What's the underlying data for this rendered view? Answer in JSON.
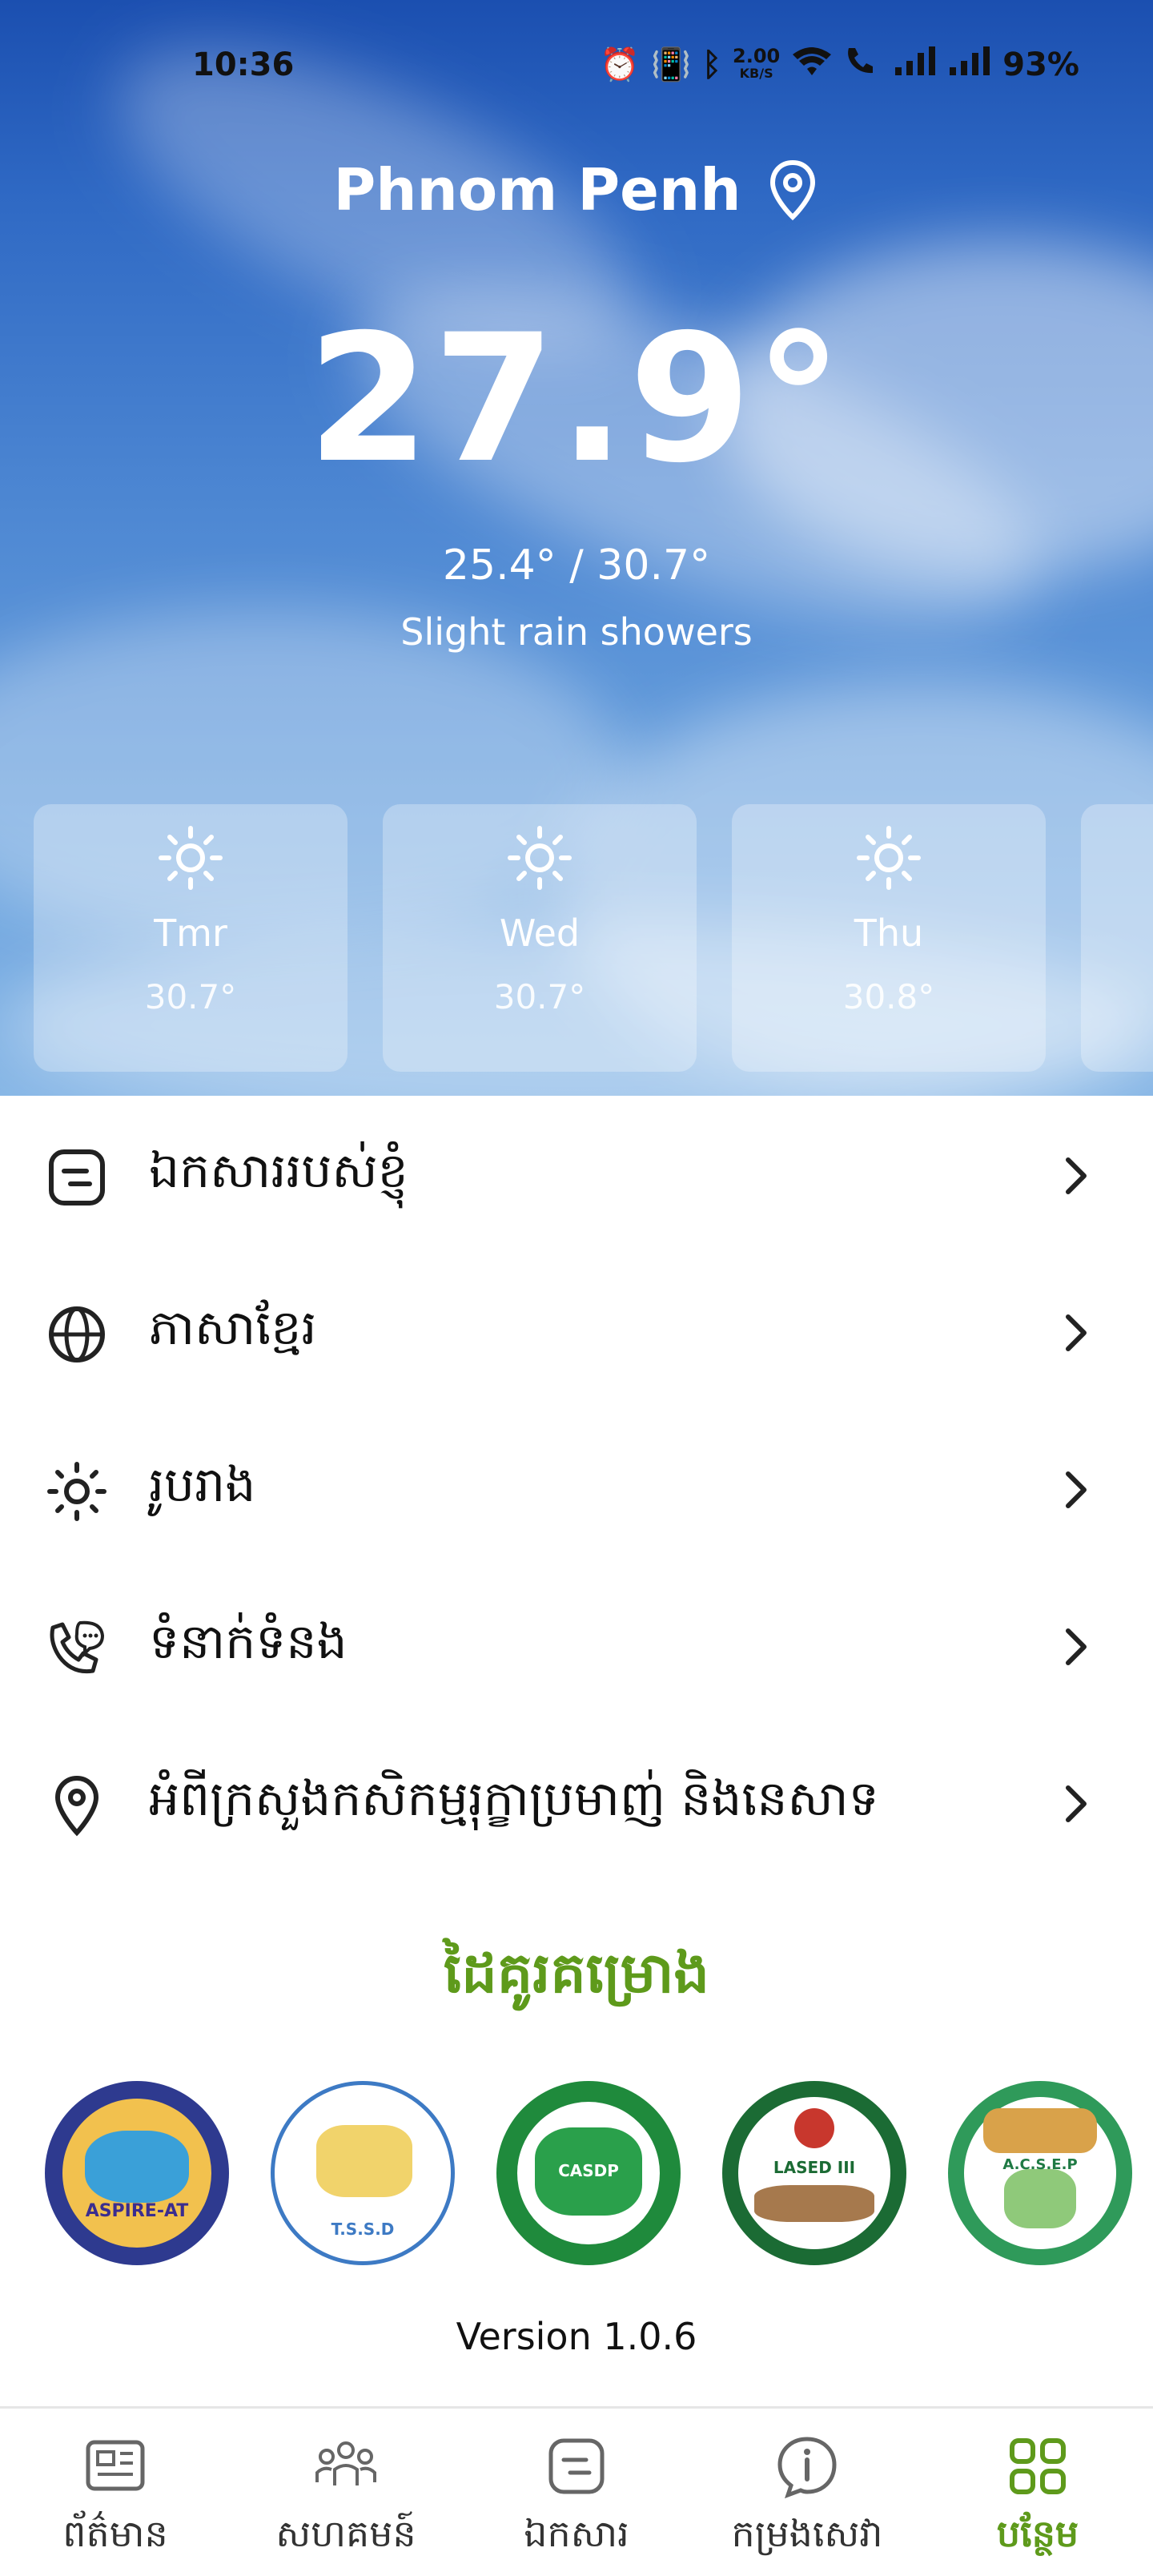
{
  "status_bar": {
    "time": "10:36",
    "speed_value": "2.00",
    "speed_unit": "KB/S",
    "battery": "93%"
  },
  "weather": {
    "city": "Phnom Penh",
    "temperature": "27.9°",
    "range": "25.4° / 30.7°",
    "condition": "Slight rain showers",
    "forecast": [
      {
        "day": "Tmr",
        "temp": "30.7°",
        "icon": "sun-icon"
      },
      {
        "day": "Wed",
        "temp": "30.7°",
        "icon": "sun-icon"
      },
      {
        "day": "Thu",
        "temp": "30.8°",
        "icon": "sun-icon"
      }
    ]
  },
  "menu": {
    "items": [
      {
        "label": "ឯកសាររបស់ខ្ញុំ",
        "icon": "document-icon"
      },
      {
        "label": "ភាសាខ្មែរ",
        "icon": "globe-icon"
      },
      {
        "label": "រូបរាង",
        "icon": "sun-icon"
      },
      {
        "label": "ទំនាក់ទំនង",
        "icon": "phone-chat-icon"
      },
      {
        "label": "អំពីក្រសួងកសិកម្មរុក្ខាប្រមាញ់ និងនេសាទ",
        "icon": "location-pin-icon"
      }
    ]
  },
  "partners": {
    "title": "ដៃគូរគម្រោង",
    "logos": [
      {
        "name": "ASPIRE-AT",
        "caption": "ASPIRE-AT"
      },
      {
        "name": "TSSD",
        "caption": "T.S.S.D"
      },
      {
        "name": "CASDP",
        "caption": "CASDP"
      },
      {
        "name": "LASED III",
        "caption": "LASED III"
      },
      {
        "name": "ACSEP",
        "caption": "A.C.S.E.P"
      }
    ]
  },
  "version": "Version 1.0.6",
  "bottom_nav": {
    "items": [
      {
        "label": "ព័ត៌មាន",
        "icon": "news-icon",
        "active": false
      },
      {
        "label": "សហគមន៍",
        "icon": "community-icon",
        "active": false
      },
      {
        "label": "ឯកសារ",
        "icon": "document-icon",
        "active": false
      },
      {
        "label": "កម្រងសេវា",
        "icon": "info-icon",
        "active": false
      },
      {
        "label": "បន្ថែម",
        "icon": "grid-icon",
        "active": true
      }
    ]
  },
  "colors": {
    "accent_green": "#5e9a1b",
    "sky_blue": "#2f69c4"
  }
}
